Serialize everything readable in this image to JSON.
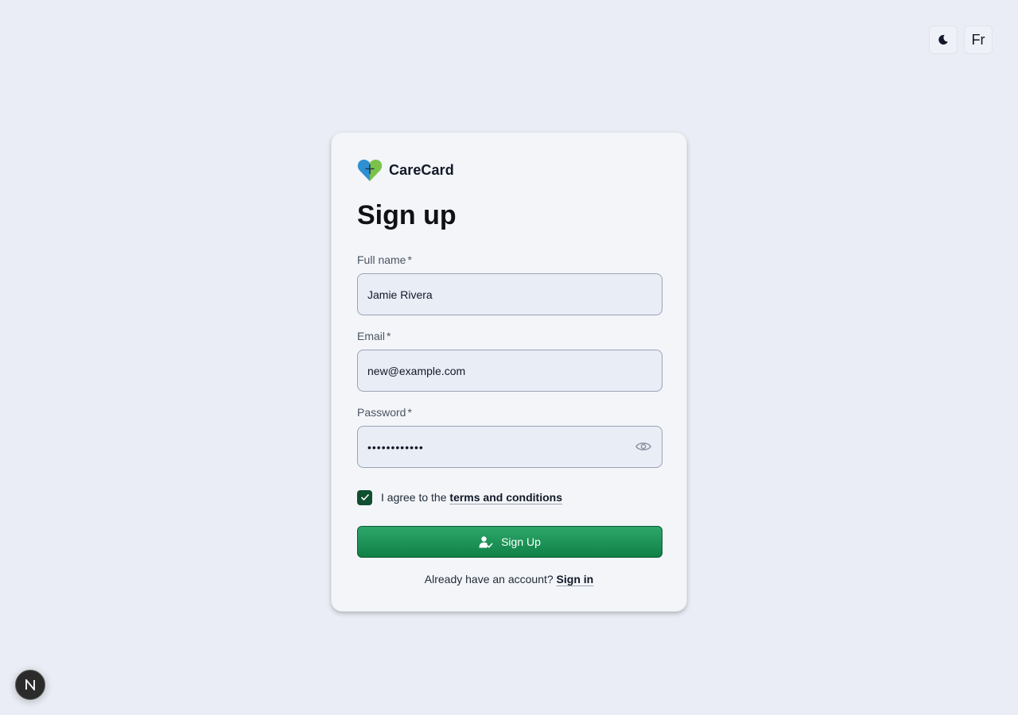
{
  "header": {
    "theme_icon": "moon-icon",
    "language_label": "Fr"
  },
  "brand": {
    "name": "CareCard",
    "logo_icon": "heart-plus-logo"
  },
  "form": {
    "title": "Sign up",
    "required_marker": "*",
    "full_name": {
      "label": "Full name",
      "value": "Jamie Rivera"
    },
    "email": {
      "label": "Email",
      "value": "new@example.com"
    },
    "password": {
      "label": "Password",
      "value": "••••••••••••",
      "toggle_icon": "eye-icon"
    },
    "agree": {
      "checked": true,
      "text": "I agree to the",
      "link_text": "terms and conditions"
    },
    "submit_label": "Sign Up",
    "submit_icon": "user-check-icon",
    "signin_prompt": "Already have an account?",
    "signin_link": "Sign in"
  },
  "dev_badge": {
    "label": "N"
  },
  "colors": {
    "page_bg": "#eaedf5",
    "card_bg": "#f3f5f9",
    "primary": "#108046",
    "checkbox": "#0f4f2f",
    "logo_blue": "#2f8fd3",
    "logo_green": "#7cc24a"
  }
}
